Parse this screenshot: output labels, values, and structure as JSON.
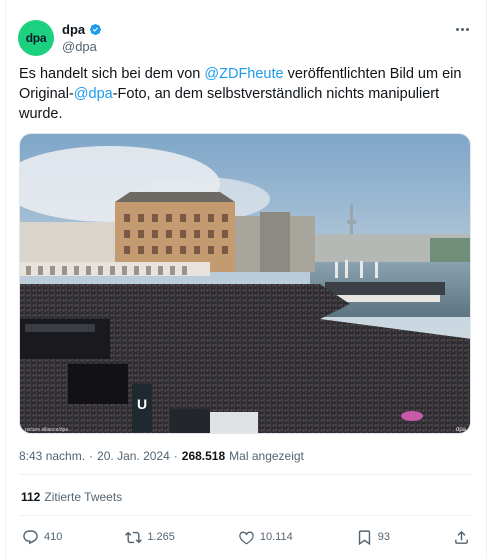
{
  "author": {
    "avatar_text": "dpa",
    "name": "dpa",
    "handle": "@dpa",
    "verified": true
  },
  "tweet": {
    "text_1": "Es handelt sich bei dem von ",
    "mention_1": "@ZDFheute",
    "text_2": " veröffentlichten Bild um ein Original-",
    "mention_2": "@dpa",
    "text_3": "-Foto, an dem selbstverständlich nichts manipuliert wurde."
  },
  "photo": {
    "watermark_left": "picture alliance/dpa",
    "watermark_right": "dpa"
  },
  "meta": {
    "time": "8:43 nachm.",
    "separator": "·",
    "date": "20. Jan. 2024",
    "views": "268.518",
    "views_label": "Mal angezeigt"
  },
  "quotes": {
    "count": "112",
    "label": "Zitierte Tweets"
  },
  "actions": {
    "replies": "410",
    "retweets": "1.265",
    "likes": "10.114",
    "bookmarks": "93"
  },
  "colors": {
    "accent": "#1d9bf0",
    "avatar_bg": "#1bd07f",
    "muted_text": "#536471"
  }
}
